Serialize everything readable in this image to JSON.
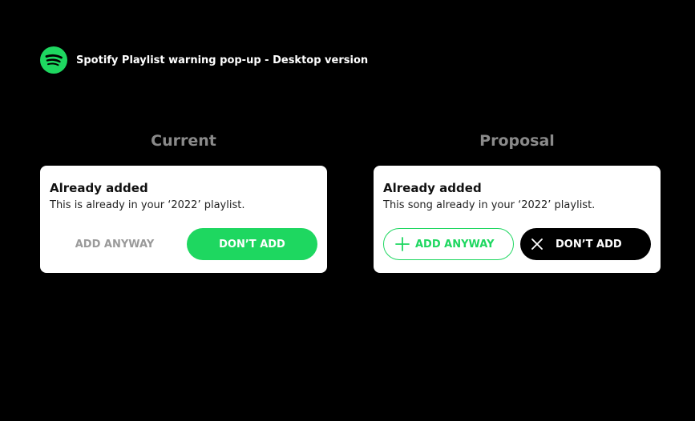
{
  "header": {
    "title": "Spotify Playlist warning pop-up - Desktop version",
    "logo_icon": "spotify-logo-icon"
  },
  "colors": {
    "background": "#000000",
    "spotify_green": "#1ed760",
    "muted_title": "#8a8a8a",
    "card": "#ffffff"
  },
  "current": {
    "column_title": "Current",
    "heading": "Already added",
    "message": "This is already in your ‘2022’ playlist.",
    "secondary_button": "ADD ANYWAY",
    "primary_button": "DON’T ADD"
  },
  "proposal": {
    "column_title": "Proposal",
    "heading": "Already added",
    "message": "This song already in your ‘2022’ playlist.",
    "secondary_button": "ADD ANYWAY",
    "secondary_icon": "plus-icon",
    "primary_button": "DON’T ADD",
    "primary_icon": "close-icon"
  }
}
